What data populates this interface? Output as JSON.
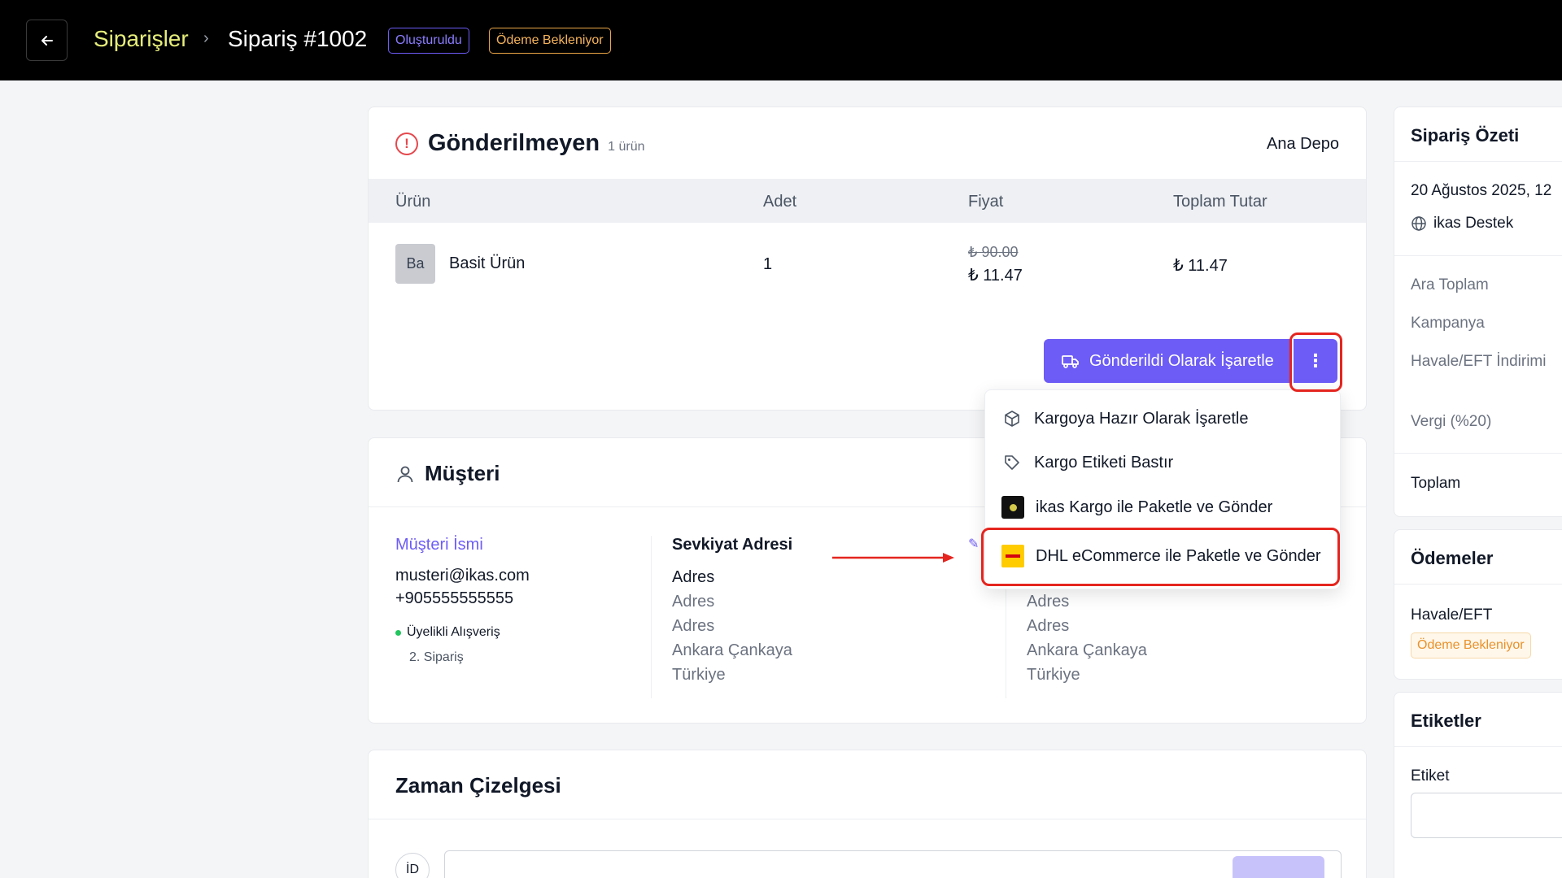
{
  "header": {
    "breadcrumb_parent": "Siparişler",
    "breadcrumb_separator": "›",
    "breadcrumb_current": "Sipariş #1002",
    "badge_status": "Oluşturuldu",
    "badge_payment": "Ödeme Bekleniyor"
  },
  "unsent": {
    "title": "Gönderilmeyen",
    "count": "1 ürün",
    "warehouse": "Ana Depo",
    "columns": [
      "Ürün",
      "Adet",
      "Fiyat",
      "Toplam Tutar"
    ],
    "item": {
      "thumb": "Ba",
      "name": "Basit Ürün",
      "quantity": "1",
      "price_old": "₺ 90.00",
      "price": "₺ 11.47",
      "total": "₺ 11.47"
    },
    "ship_button": "Gönderildi Olarak İşaretle",
    "more_button": "⋮"
  },
  "dropdown": {
    "items": [
      {
        "label": "Kargoya Hazır Olarak İşaretle",
        "icon": "box-icon"
      },
      {
        "label": "Kargo Etiketi Bastır",
        "icon": "tag-icon"
      },
      {
        "label": "ikas Kargo ile Paketle ve Gönder",
        "icon": "ikas-logo"
      },
      {
        "label": "DHL eCommerce ile Paketle ve Gönder",
        "icon": "dhl-logo"
      }
    ]
  },
  "customer": {
    "title": "Müşteri",
    "name": "Müşteri İsmi",
    "email": "musteri@ikas.com",
    "phone": "+905555555555",
    "membership": "Üyelikli Alışveriş",
    "order_count": "2. Sipariş",
    "shipping_label": "Sevkiyat Adresi",
    "shipping_lines": [
      "Adres",
      "Adres",
      "Adres",
      "Ankara Çankaya",
      "Türkiye"
    ],
    "billing_lines": [
      "Adres",
      "Adres",
      "Ankara Çankaya",
      "Türkiye"
    ]
  },
  "timeline": {
    "title": "Zaman Çizelgesi",
    "avatar": "İD"
  },
  "summary": {
    "title": "Sipariş Özeti",
    "date": "20 Ağustos 2025, 12",
    "channel": "ikas Destek",
    "rows": [
      "Ara Toplam",
      "Kampanya",
      "Havale/EFT İndirimi",
      "Vergi (%20)"
    ],
    "total_label": "Toplam"
  },
  "payments": {
    "title": "Ödemeler",
    "method": "Havale/EFT",
    "status": "Ödeme Bekleniyor"
  },
  "tags": {
    "title": "Etiketler",
    "label": "Etiket"
  },
  "colors": {
    "accent": "#6d5cf6",
    "highlight": "#e5251f",
    "breadcrumb": "#e6ee7a"
  }
}
